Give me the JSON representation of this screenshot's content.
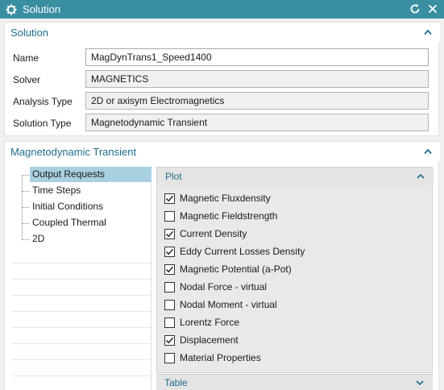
{
  "window": {
    "title": "Solution",
    "icons": {
      "app": "gear-icon",
      "reset": "reset-icon",
      "close": "close-icon"
    },
    "accent_color": "#3a8ea2"
  },
  "solution_section": {
    "title": "Solution",
    "fields": [
      {
        "label": "Name",
        "value": "MagDynTrans1_Speed1400",
        "editable": true
      },
      {
        "label": "Solver",
        "value": "MAGNETICS",
        "editable": false
      },
      {
        "label": "Analysis Type",
        "value": "2D or axisym Electromagnetics",
        "editable": false
      },
      {
        "label": "Solution Type",
        "value": "Magnetodynamic Transient",
        "editable": false
      }
    ]
  },
  "transient_section": {
    "title": "Magnetodynamic Transient",
    "tree": [
      {
        "label": "Output Requests",
        "selected": true
      },
      {
        "label": "Time Steps",
        "selected": false
      },
      {
        "label": "Initial Conditions",
        "selected": false
      },
      {
        "label": "Coupled Thermal",
        "selected": false
      },
      {
        "label": "2D",
        "selected": false
      }
    ],
    "plot_group": {
      "title": "Plot",
      "options": [
        {
          "label": "Magnetic Fluxdensity",
          "checked": true
        },
        {
          "label": "Magnetic Fieldstrength",
          "checked": false
        },
        {
          "label": "Current Density",
          "checked": true
        },
        {
          "label": "Eddy Current Losses Density",
          "checked": true
        },
        {
          "label": "Magnetic Potential (a-Pot)",
          "checked": true
        },
        {
          "label": "Nodal Force - virtual",
          "checked": false
        },
        {
          "label": "Nodal Moment - virtual",
          "checked": false
        },
        {
          "label": "Lorentz Force",
          "checked": false
        },
        {
          "label": "Displacement",
          "checked": true
        },
        {
          "label": "Material Properties",
          "checked": false
        }
      ]
    },
    "table_group": {
      "title": "Table"
    }
  }
}
